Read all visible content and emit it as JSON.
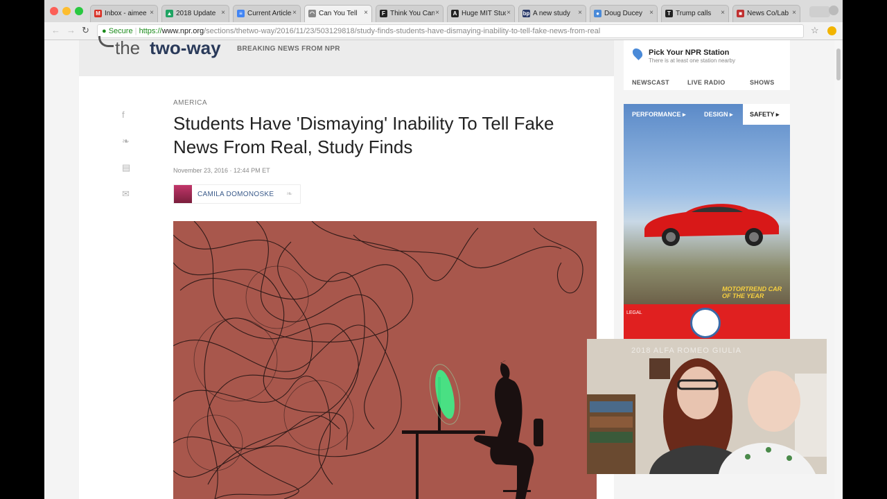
{
  "browser": {
    "tabs": [
      {
        "label": "Inbox - aimee",
        "fav": "M",
        "fav_color": "#d93025",
        "active": false
      },
      {
        "label": "2018 Update",
        "fav": "▲",
        "fav_color": "#1fa463",
        "active": false
      },
      {
        "label": "Current Articles",
        "fav": "≡",
        "fav_color": "#4285f4",
        "active": false
      },
      {
        "label": "Can You Tell",
        "fav": "◠",
        "fav_color": "#888888",
        "active": true
      },
      {
        "label": "Think You Can",
        "fav": "F",
        "fav_color": "#222222",
        "active": false
      },
      {
        "label": "Huge MIT Study",
        "fav": "A",
        "fav_color": "#222222",
        "active": false
      },
      {
        "label": "A new study",
        "fav": "bp",
        "fav_color": "#2a3a6a",
        "active": false
      },
      {
        "label": "Doug Ducey",
        "fav": "●",
        "fav_color": "#4a8ad8",
        "active": false
      },
      {
        "label": "Trump calls",
        "fav": "T",
        "fav_color": "#222222",
        "active": false
      },
      {
        "label": "News Co/Lab",
        "fav": "■",
        "fav_color": "#c03030",
        "active": false
      }
    ],
    "tab_close": "×",
    "secure_label": "Secure",
    "url_scheme": "https://",
    "url_host": "www.npr.org",
    "url_path": "/sections/thetwo-way/2016/11/23/503129818/study-finds-students-have-dismaying-inability-to-tell-fake-news-from-real",
    "back_glyph": "←",
    "forward_glyph": "→",
    "reload_glyph": "↻",
    "star_glyph": "☆"
  },
  "masthead": {
    "the": "the",
    "two_way": "two-way",
    "tagline": "BREAKING NEWS FROM NPR"
  },
  "article": {
    "kicker": "AMERICA",
    "headline": "Students Have 'Dismaying' Inability To Tell Fake News From Real, Study Finds",
    "dateline": "November 23, 2016 · 12:44 PM ET",
    "author": "CAMILA DOMONOSKE",
    "share_icons": [
      "f",
      "❧",
      "▤",
      "✉"
    ]
  },
  "sidebar": {
    "station_title": "Pick Your NPR Station",
    "station_sub": "There is at least one station nearby",
    "nav": [
      "NEWSCAST",
      "LIVE RADIO",
      "SHOWS"
    ],
    "ad_tabs": [
      "PERFORMANCE ▸",
      "DESIGN ▸",
      "SAFETY ▸"
    ],
    "ad_badge": "MOTORTREND CAR OF THE YEAR",
    "ad_legal": "LEGAL"
  },
  "webcam": {
    "overlay_text": "2018 ALFA ROMEO GIULIA"
  }
}
